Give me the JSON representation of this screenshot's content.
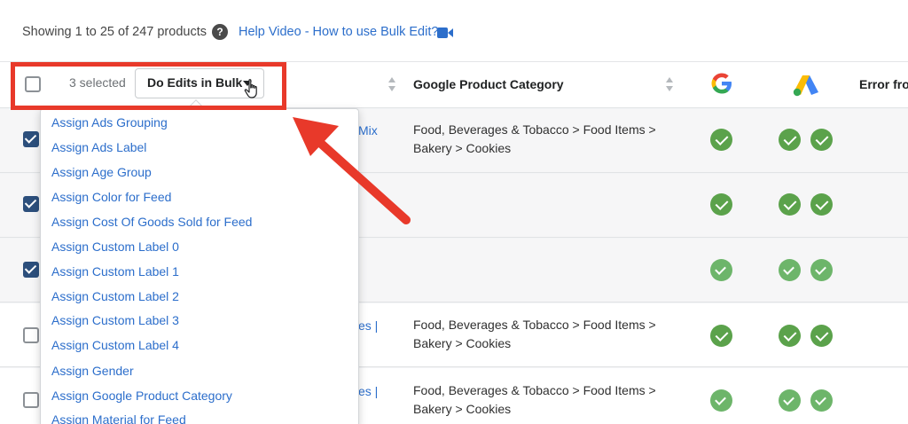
{
  "toolbar": {
    "showing_text": "Showing 1 to 25 of 247 products",
    "help_q": "?",
    "help_link": "Help Video - How to use Bulk Edit?"
  },
  "table_header": {
    "selected_count": "3 selected",
    "bulk_button": "Do Edits in Bulk",
    "gpc_label": "Google Product Category",
    "error_label": "Error from"
  },
  "rows": [
    {
      "checked": true,
      "frag": "Mix",
      "gpc_line1": "Food, Beverages & Tobacco > Food Items >",
      "gpc_line2": "Bakery > Cookies",
      "status": "approved"
    },
    {
      "checked": true,
      "frag": "",
      "gpc_line1": "",
      "gpc_line2": "",
      "status": "approved"
    },
    {
      "checked": true,
      "frag": "",
      "gpc_line1": "",
      "gpc_line2": "",
      "status": "pending"
    },
    {
      "checked": false,
      "frag": "es |",
      "gpc_line1": "Food, Beverages & Tobacco > Food Items >",
      "gpc_line2": "Bakery > Cookies",
      "status": "approved"
    },
    {
      "checked": false,
      "frag": "es |",
      "gpc_line1": "Food, Beverages & Tobacco > Food Items >",
      "gpc_line2": "Bakery > Cookies",
      "status": "pending"
    }
  ],
  "dropdown": {
    "items": [
      "Assign Ads Grouping",
      "Assign Ads Label",
      "Assign Age Group",
      "Assign Color for Feed",
      "Assign Cost Of Goods Sold for Feed",
      "Assign Custom Label 0",
      "Assign Custom Label 1",
      "Assign Custom Label 2",
      "Assign Custom Label 3",
      "Assign Custom Label 4",
      "Assign Gender",
      "Assign Google Product Category",
      "Assign Material for Feed"
    ]
  },
  "colors": {
    "annotation_red": "#e8392a",
    "link_blue": "#2c6ecb",
    "check_green": "#5ba24b",
    "checkbox_navy": "#2c4f7c"
  }
}
